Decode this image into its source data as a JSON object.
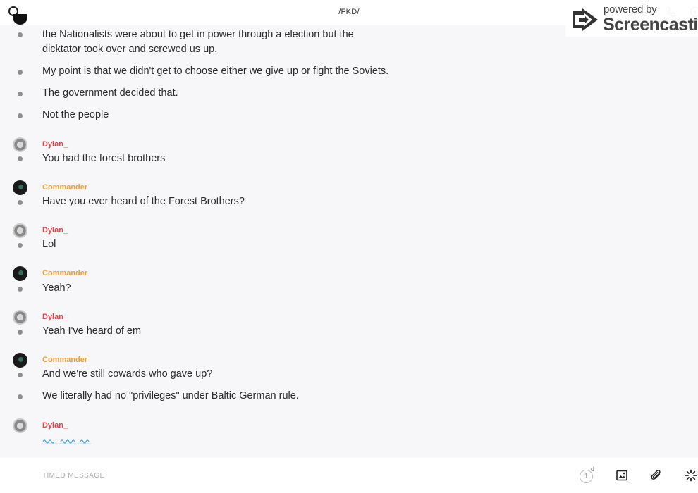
{
  "header": {
    "title": "/FKD/",
    "search_icon": "search-icon",
    "phone_icon": "phone-icon",
    "info_icon": "info-icon"
  },
  "watermark": {
    "powered": "powered by",
    "brand": "Screencastify"
  },
  "messages": [
    {
      "author": "",
      "lines": [
        "the Nationalists were about to get in power through a election but the",
        "dicktator took over and screwed us up."
      ]
    },
    {
      "author": "",
      "lines": [
        "My point is that we didn't get to choose either we give up or fight the Soviets."
      ]
    },
    {
      "author": "",
      "lines": [
        "The government decided that."
      ]
    },
    {
      "author": "",
      "lines": [
        "Not the people"
      ]
    },
    {
      "author": "Dylan_",
      "lines": [
        "You had the forest brothers"
      ]
    },
    {
      "author": "Commander",
      "lines": [
        "Have you ever heard of the Forest Brothers?"
      ]
    },
    {
      "author": "Dylan_",
      "lines": [
        "Lol"
      ]
    },
    {
      "author": "Commander",
      "lines": [
        "Yeah?"
      ]
    },
    {
      "author": "Dylan_",
      "lines": [
        "Yeah I've heard of em"
      ]
    },
    {
      "author": "Commander",
      "lines": [
        "And we're still cowards who gave up?"
      ]
    },
    {
      "author": "",
      "lines": [
        "We literally had no \"privileges\" under Baltic German rule."
      ]
    },
    {
      "author": "Dylan_",
      "lines": []
    }
  ],
  "composer": {
    "placeholder": "TIMED MESSAGE",
    "timer_value": "1",
    "timer_unit": "d",
    "image_icon": "image-icon",
    "attach_icon": "paperclip-icon",
    "burst_icon": "sparkle-icon"
  },
  "colors": {
    "dylan": "#e2464b",
    "commander": "#f0a03b",
    "typing": "#4aa3df"
  }
}
